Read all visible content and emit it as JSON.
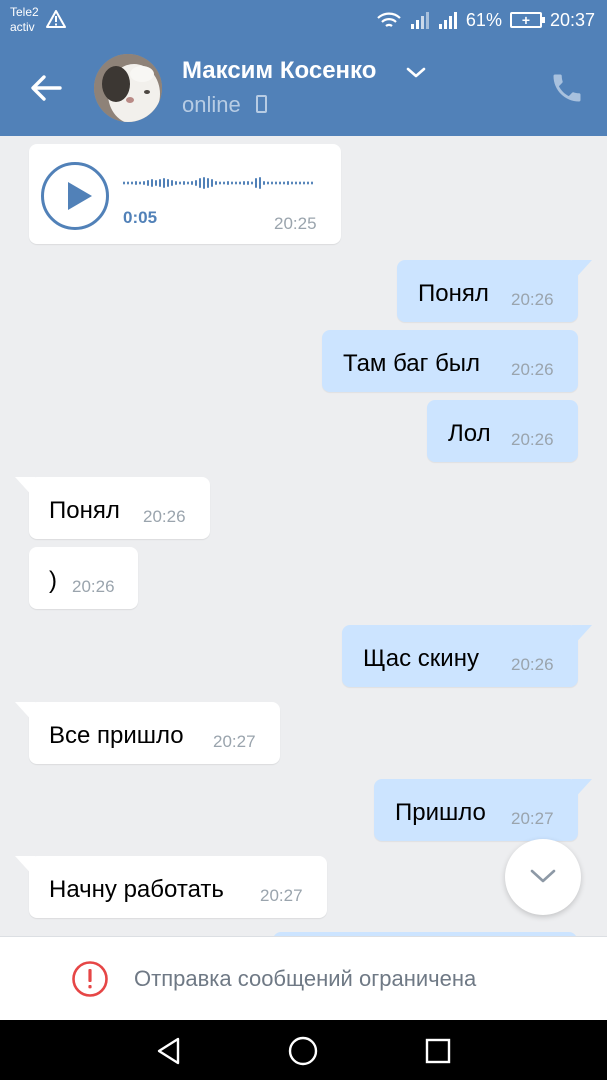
{
  "status_bar": {
    "carrier_line1": "Tele2",
    "carrier_line2": "activ",
    "battery_percent": "61%",
    "time": "20:37"
  },
  "header": {
    "contact_name": "Максим Косенко",
    "status": "online",
    "back_icon": "arrow-left-icon",
    "call_icon": "phone-icon",
    "colors": {
      "bar": "#5181b8",
      "status": "#b7cce4"
    }
  },
  "messages": [
    {
      "direction": "in",
      "type": "voice",
      "duration": "0:05",
      "time": "20:25"
    },
    {
      "direction": "out",
      "text": "Понял",
      "time": "20:26"
    },
    {
      "direction": "out",
      "text": "Там баг был",
      "time": "20:26"
    },
    {
      "direction": "out",
      "text": "Лол",
      "time": "20:26"
    },
    {
      "direction": "in",
      "text": "Понял",
      "time": "20:26"
    },
    {
      "direction": "in",
      "text": ")",
      "time": "20:26"
    },
    {
      "direction": "out",
      "text": "Щас скину",
      "time": "20:26"
    },
    {
      "direction": "in",
      "text": "Все пришло",
      "time": "20:27"
    },
    {
      "direction": "out",
      "text": "Пришло",
      "time": "20:27"
    },
    {
      "direction": "in",
      "text": "Начну работать",
      "time": "20:27"
    }
  ],
  "colors": {
    "incoming": "#ffffff",
    "outgoing": "#cce4ff",
    "background": "#edeef0",
    "accent": "#5181b8",
    "alert": "#e64646"
  },
  "restriction": {
    "text": "Отправка сообщений ограничена",
    "icon": "alert-circle-icon"
  },
  "navbar": {
    "icons": [
      "back-triangle-icon",
      "home-circle-icon",
      "recents-square-icon"
    ]
  }
}
